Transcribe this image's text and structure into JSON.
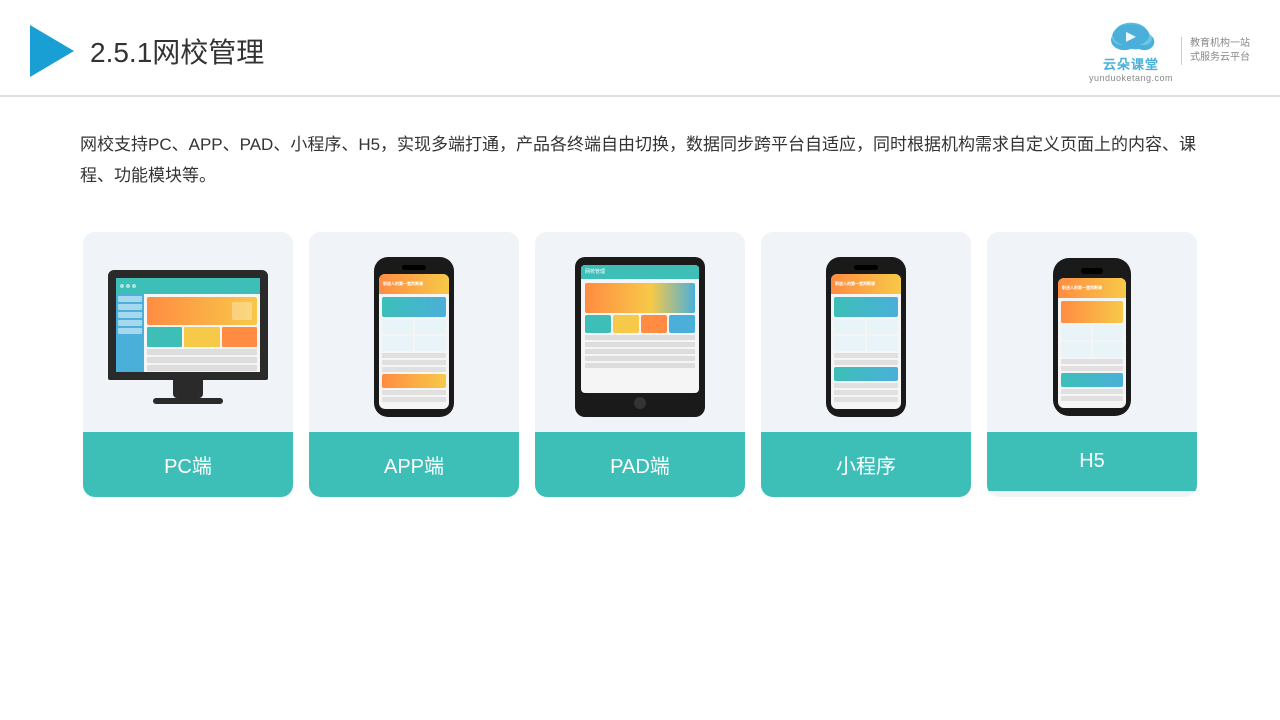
{
  "header": {
    "title_number": "2.5.1",
    "title_text": "网校管理",
    "logo_main": "云朵课堂",
    "logo_domain": "yunduoketang.com",
    "logo_tagline_1": "教育机构一站",
    "logo_tagline_2": "式服务云平台"
  },
  "description": {
    "text": "网校支持PC、APP、PAD、小程序、H5，实现多端打通，产品各终端自由切换，数据同步跨平台自适应，同时根据机构需求自定义页面上的内容、课程、功能模块等。"
  },
  "cards": [
    {
      "id": "pc",
      "label": "PC端"
    },
    {
      "id": "app",
      "label": "APP端"
    },
    {
      "id": "pad",
      "label": "PAD端"
    },
    {
      "id": "miniprogram",
      "label": "小程序"
    },
    {
      "id": "h5",
      "label": "H5"
    }
  ],
  "colors": {
    "accent": "#3dbfb8",
    "header_line": "#e0e0e0",
    "card_bg": "#f0f4f8",
    "text_dark": "#333333"
  }
}
